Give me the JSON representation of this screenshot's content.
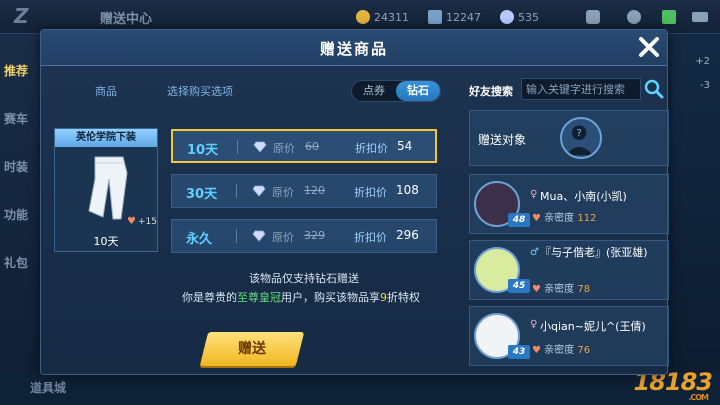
{
  "background": {
    "title": "赠送中心",
    "coins": "24311",
    "tickets": "12247",
    "diamonds": "535",
    "left_menu": [
      "推荐",
      "赛车",
      "时装",
      "功能",
      "礼包"
    ],
    "right_nums": [
      "+2",
      "-3"
    ],
    "bottom_text": "道具城"
  },
  "modal": {
    "title": "赠送商品",
    "left": {
      "goods_label": "商品",
      "options_label": "选择购买选项",
      "currency_tabs": [
        "点券",
        "钻石"
      ],
      "active_currency": "钻石"
    },
    "item": {
      "name": "英伦学院下装",
      "intimacy_bonus": "+15",
      "duration": "10天"
    },
    "price_options": [
      {
        "duration": "10天",
        "orig_label": "原价",
        "orig": "60",
        "disc_label": "折扣价",
        "disc": "54",
        "selected": true
      },
      {
        "duration": "30天",
        "orig_label": "原价",
        "orig": "120",
        "disc_label": "折扣价",
        "disc": "108",
        "selected": false
      },
      {
        "duration": "永久",
        "orig_label": "原价",
        "orig": "329",
        "disc_label": "折扣价",
        "disc": "296",
        "selected": false
      }
    ],
    "notice_line1": "该物品仅支持钻石赠送",
    "notice_line2": {
      "pre": "你是尊贵的",
      "vip": "至尊皇冠",
      "mid": "用户，购买该物品享",
      "discount": "9",
      "post": "折特权"
    },
    "gift_button": "赠送",
    "right": {
      "search_label": "好友搜索",
      "search_placeholder": "输入关键字进行搜索",
      "target_label": "赠送对象",
      "friends": [
        {
          "gender": "♀",
          "name": "Mua、小南(小凯)",
          "level": "48",
          "intimacy_label": "亲密度",
          "intimacy": "112"
        },
        {
          "gender": "♂",
          "name": "『与子偕老』(张亚雄)",
          "level": "45",
          "intimacy_label": "亲密度",
          "intimacy": "78"
        },
        {
          "gender": "♀",
          "name": "小qian~妮儿^(王倩)",
          "level": "43",
          "intimacy_label": "亲密度",
          "intimacy": "76"
        }
      ]
    }
  },
  "watermark": "18183",
  "watermark_url": ".COM",
  "colors": {
    "accent_blue": "#2477bd",
    "selected_border": "#f2c53b",
    "gift_button": "#f0b623",
    "duration_text": "#5fd0ff"
  }
}
